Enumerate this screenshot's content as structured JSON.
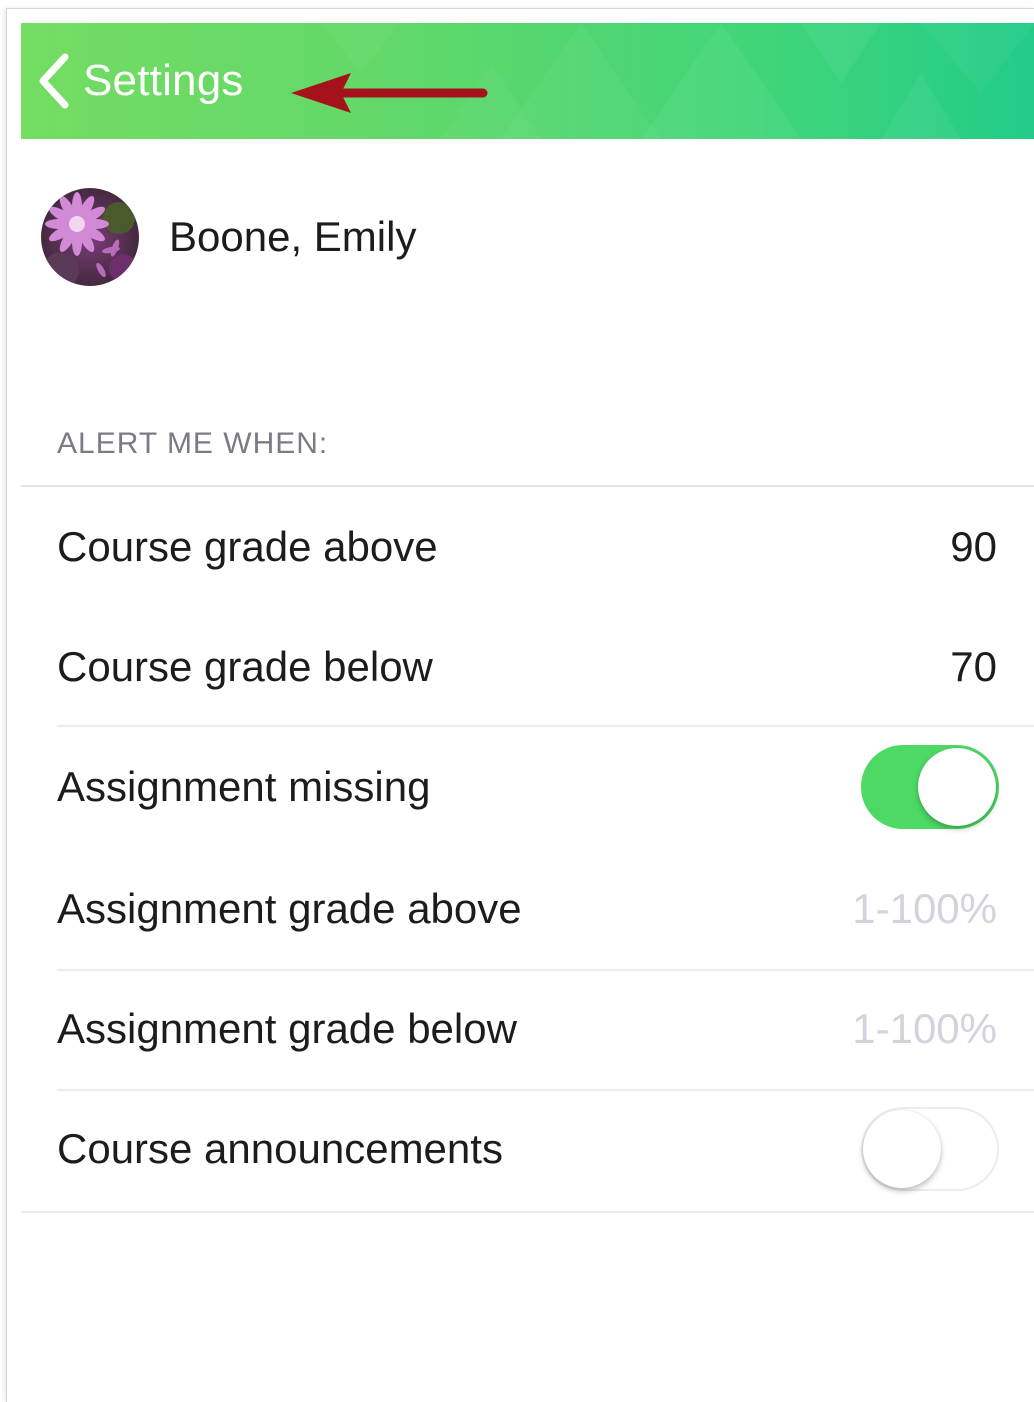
{
  "nav": {
    "back_label": "Settings",
    "back_icon": "chevron-left-icon",
    "annotation": "red-arrow-pointing-left",
    "gradient_start": "#74dc62",
    "gradient_end": "#22cc88"
  },
  "profile": {
    "name": "Boone, Emily",
    "avatar": "flower-photo-avatar"
  },
  "alerts": {
    "header": "ALERT ME WHEN:",
    "rows": [
      {
        "label": "Course grade above",
        "value": "90"
      },
      {
        "label": "Course grade below",
        "value": "70"
      },
      {
        "label": "Assignment missing",
        "toggle": true
      },
      {
        "label": "Assignment grade above",
        "placeholder": "1-100%"
      },
      {
        "label": "Assignment grade below",
        "placeholder": "1-100%"
      },
      {
        "label": "Course announcements",
        "toggle": false
      }
    ]
  },
  "colors": {
    "toggle_on": "#4cd964",
    "annotation_red": "#a5121c"
  }
}
